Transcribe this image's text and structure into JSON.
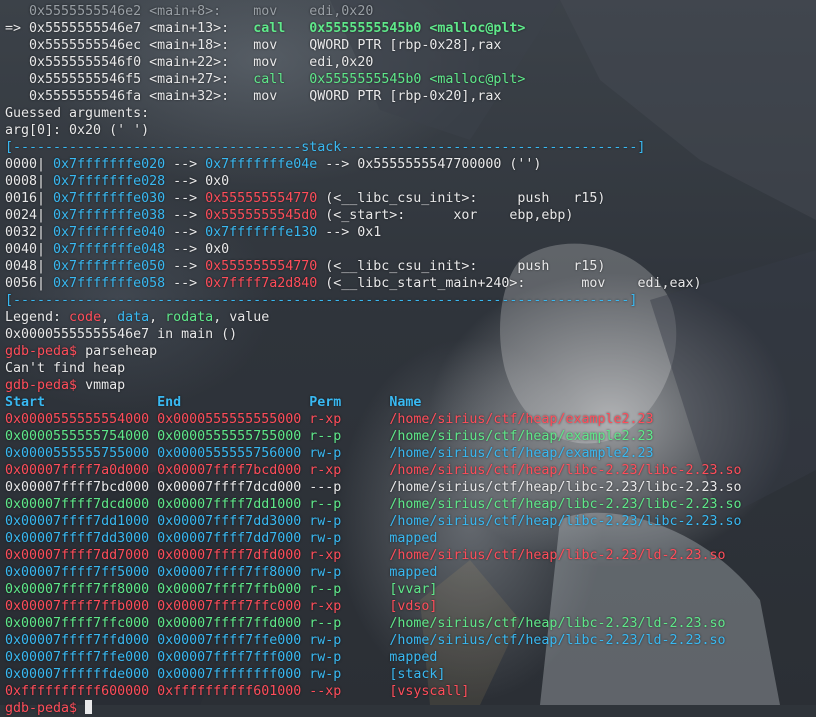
{
  "colors": {
    "code": "#ff4d5a",
    "data": "#39b9f2",
    "rodata": "#5fe98a",
    "value": "#e9e9ea",
    "prompt": "#ff4d5a",
    "header": "#39b9f2",
    "dim": "#9aa0a6"
  },
  "disasm": [
    {
      "marker": "   ",
      "addr": "0x5555555546e2",
      "sym": "<main+8>:",
      "op": "mov",
      "args": "edi,0x20",
      "style": "dim"
    },
    {
      "marker": "=> ",
      "addr": "0x5555555546e7",
      "sym": "<main+13>:",
      "op": "call",
      "target": "0x5555555545b0",
      "target_sym": "<malloc@plt>",
      "style": "current"
    },
    {
      "marker": "   ",
      "addr": "0x5555555546ec",
      "sym": "<main+18>:",
      "op": "mov",
      "args": "QWORD PTR [rbp-0x28],rax",
      "style": "normal"
    },
    {
      "marker": "   ",
      "addr": "0x5555555546f0",
      "sym": "<main+22>:",
      "op": "mov",
      "args": "edi,0x20",
      "style": "normal"
    },
    {
      "marker": "   ",
      "addr": "0x5555555546f5",
      "sym": "<main+27>:",
      "op": "call",
      "target": "0x5555555545b0",
      "target_sym": "<malloc@plt>",
      "style": "call"
    },
    {
      "marker": "   ",
      "addr": "0x5555555546fa",
      "sym": "<main+32>:",
      "op": "mov",
      "args": "QWORD PTR [rbp-0x20],rax",
      "style": "normal"
    }
  ],
  "guessed": {
    "title": "Guessed arguments:",
    "arg0": "arg[0]: 0x20 (' ')"
  },
  "stack": {
    "top_left": "[------------------------------------",
    "label": "stack",
    "top_right": "-------------------------------------]",
    "bottom": "[-----------------------------------------------------------------------------]",
    "rows": [
      {
        "off": "0000|",
        "addr": "0x7fffffffe020",
        "arrow": " --> ",
        "val": "0x7fffffffe04e",
        "val_color": "blue",
        "rest": " --> 0x5555555547700000 ('')"
      },
      {
        "off": "0008|",
        "addr": "0x7fffffffe028",
        "arrow": " --> ",
        "val": "0x0",
        "val_color": "fg",
        "rest": ""
      },
      {
        "off": "0016|",
        "addr": "0x7fffffffe030",
        "arrow": " --> ",
        "val": "0x555555554770",
        "val_color": "red",
        "rest": " (<__libc_csu_init>:     push   r15)"
      },
      {
        "off": "0024|",
        "addr": "0x7fffffffe038",
        "arrow": " --> ",
        "val": "0x5555555545d0",
        "val_color": "red",
        "rest": " (<_start>:      xor    ebp,ebp)"
      },
      {
        "off": "0032|",
        "addr": "0x7fffffffe040",
        "arrow": " --> ",
        "val": "0x7fffffffe130",
        "val_color": "blue",
        "rest": " --> 0x1"
      },
      {
        "off": "0040|",
        "addr": "0x7fffffffe048",
        "arrow": " --> ",
        "val": "0x0",
        "val_color": "fg",
        "rest": ""
      },
      {
        "off": "0048|",
        "addr": "0x7fffffffe050",
        "arrow": " --> ",
        "val": "0x555555554770",
        "val_color": "red",
        "rest": " (<__libc_csu_init>:     push   r15)"
      },
      {
        "off": "0056|",
        "addr": "0x7fffffffe058",
        "arrow": " --> ",
        "val": "0x7ffff7a2d840",
        "val_color": "red",
        "rest": " (<__libc_start_main+240>:       mov    edi,eax)"
      }
    ]
  },
  "legend": {
    "prefix": "Legend: ",
    "code": "code",
    "sep1": ", ",
    "data": "data",
    "sep2": ", ",
    "rodata": "rodata",
    "sep3": ", ",
    "value": "value"
  },
  "location": "0x00005555555546e7 in main ()",
  "prompt": "gdb-peda$ ",
  "cmd1": "parseheap",
  "msg1": "Can't find heap",
  "cmd2": "vmmap",
  "vmmap": {
    "headers": {
      "start": "Start",
      "end": "End",
      "perm": "Perm",
      "name": "Name"
    },
    "rows": [
      {
        "start": "0x0000555555554000",
        "end": "0x0000555555555000",
        "perm": "r-xp",
        "name": "/home/sirius/ctf/heap/example2.23"
      },
      {
        "start": "0x0000555555754000",
        "end": "0x0000555555755000",
        "perm": "r--p",
        "name": "/home/sirius/ctf/heap/example2.23"
      },
      {
        "start": "0x0000555555755000",
        "end": "0x0000555555756000",
        "perm": "rw-p",
        "name": "/home/sirius/ctf/heap/example2.23"
      },
      {
        "start": "0x00007ffff7a0d000",
        "end": "0x00007ffff7bcd000",
        "perm": "r-xp",
        "name": "/home/sirius/ctf/heap/libc-2.23/libc-2.23.so"
      },
      {
        "start": "0x00007ffff7bcd000",
        "end": "0x00007ffff7dcd000",
        "perm": "---p",
        "name": "/home/sirius/ctf/heap/libc-2.23/libc-2.23.so"
      },
      {
        "start": "0x00007ffff7dcd000",
        "end": "0x00007ffff7dd1000",
        "perm": "r--p",
        "name": "/home/sirius/ctf/heap/libc-2.23/libc-2.23.so"
      },
      {
        "start": "0x00007ffff7dd1000",
        "end": "0x00007ffff7dd3000",
        "perm": "rw-p",
        "name": "/home/sirius/ctf/heap/libc-2.23/libc-2.23.so"
      },
      {
        "start": "0x00007ffff7dd3000",
        "end": "0x00007ffff7dd7000",
        "perm": "rw-p",
        "name": "mapped"
      },
      {
        "start": "0x00007ffff7dd7000",
        "end": "0x00007ffff7dfd000",
        "perm": "r-xp",
        "name": "/home/sirius/ctf/heap/libc-2.23/ld-2.23.so"
      },
      {
        "start": "0x00007ffff7ff5000",
        "end": "0x00007ffff7ff8000",
        "perm": "rw-p",
        "name": "mapped"
      },
      {
        "start": "0x00007ffff7ff8000",
        "end": "0x00007ffff7ffb000",
        "perm": "r--p",
        "name": "[vvar]"
      },
      {
        "start": "0x00007ffff7ffb000",
        "end": "0x00007ffff7ffc000",
        "perm": "r-xp",
        "name": "[vdso]"
      },
      {
        "start": "0x00007ffff7ffc000",
        "end": "0x00007ffff7ffd000",
        "perm": "r--p",
        "name": "/home/sirius/ctf/heap/libc-2.23/ld-2.23.so"
      },
      {
        "start": "0x00007ffff7ffd000",
        "end": "0x00007ffff7ffe000",
        "perm": "rw-p",
        "name": "/home/sirius/ctf/heap/libc-2.23/ld-2.23.so"
      },
      {
        "start": "0x00007ffff7ffe000",
        "end": "0x00007ffff7fff000",
        "perm": "rw-p",
        "name": "mapped"
      },
      {
        "start": "0x00007ffffffde000",
        "end": "0x00007ffffffff000",
        "perm": "rw-p",
        "name": "[stack]"
      },
      {
        "start": "0xffffffffff600000",
        "end": "0xffffffffff601000",
        "perm": "--xp",
        "name": "[vsyscall]"
      }
    ]
  },
  "final_prompt": "gdb-peda$ "
}
